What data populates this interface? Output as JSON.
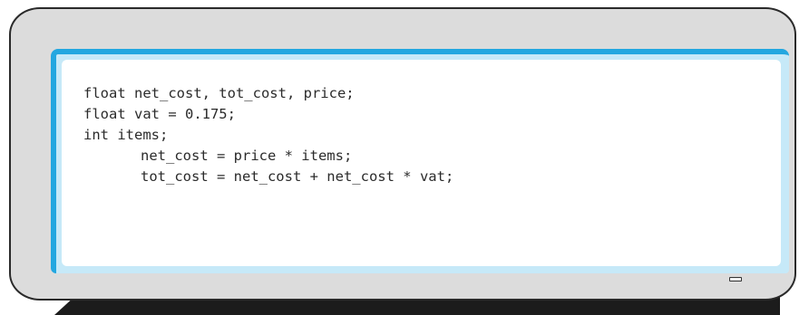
{
  "code": {
    "lines": [
      "float net_cost, tot_cost, price;",
      "float vat = 0.175;",
      "int items;",
      "net_cost = price * items;",
      "tot_cost = net_cost + net_cost * vat;"
    ]
  },
  "colors": {
    "screen_border": "#23a7e0",
    "screen_glow": "#c6e9f8",
    "monitor_body": "#dcdcdc",
    "outline": "#2a2a2a"
  }
}
